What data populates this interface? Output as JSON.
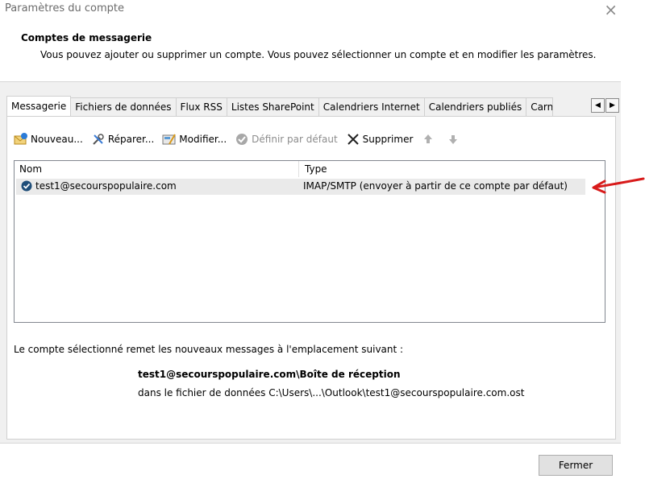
{
  "window": {
    "title": "Paramètres du compte"
  },
  "header": {
    "title": "Comptes de messagerie",
    "description": "Vous pouvez ajouter ou supprimer un compte. Vous pouvez sélectionner un compte et en modifier les paramètres."
  },
  "tabs": [
    {
      "label": "Messagerie",
      "active": true
    },
    {
      "label": "Fichiers de données"
    },
    {
      "label": "Flux RSS"
    },
    {
      "label": "Listes SharePoint"
    },
    {
      "label": "Calendriers Internet"
    },
    {
      "label": "Calendriers publiés"
    },
    {
      "label": "Carn"
    }
  ],
  "toolbar": {
    "new": "Nouveau...",
    "repair": "Réparer...",
    "modify": "Modifier...",
    "default": "Définir par défaut",
    "delete": "Supprimer"
  },
  "list": {
    "columns": [
      "Nom",
      "Type"
    ],
    "rows": [
      {
        "name": "test1@secourspopulaire.com",
        "type": "IMAP/SMTP (envoyer à partir de ce compte par défaut)"
      }
    ]
  },
  "info": {
    "label": "Le compte sélectionné remet les nouveaux messages à l'emplacement suivant :",
    "path": "test1@secourspopulaire.com\\Boîte de réception",
    "file": "dans le fichier de données C:\\Users\\...\\Outlook\\test1@secourspopulaire.com.ost"
  },
  "buttons": {
    "close": "Fermer"
  },
  "colors": {
    "annotation": "#d81b1b",
    "selected_row": "#eaeaea"
  }
}
